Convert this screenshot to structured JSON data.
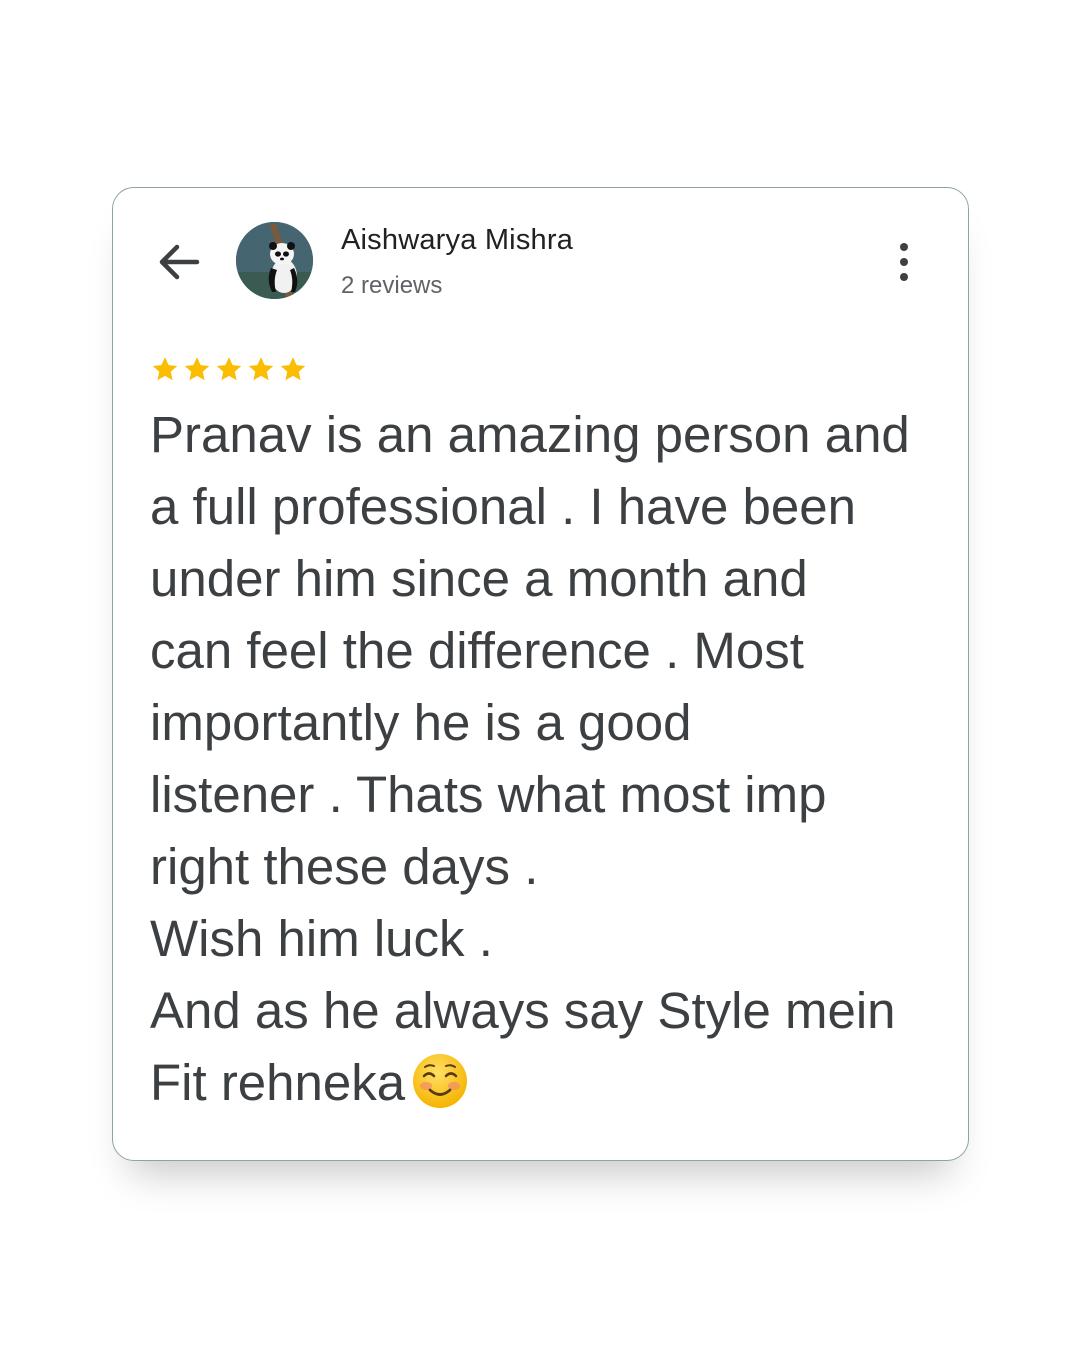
{
  "reviewer": {
    "name": "Aishwarya Mishra",
    "review_count": "2 reviews",
    "avatar_icon": "panda-avatar"
  },
  "icons": {
    "back": "arrow-left-icon",
    "more": "more-vertical-icon",
    "star": "star-icon",
    "emoji": "smiling-face-emoji"
  },
  "rating": {
    "stars": 5,
    "max": 5,
    "color": "#fbbc04"
  },
  "review": {
    "line1": "Pranav is an amazing person and",
    "line2": "a full professional . I have been",
    "line3": "under him since a month and",
    "line4": "can feel the difference . Most",
    "line5": "importantly he is a good",
    "line6": "listener . Thats what most imp",
    "line7": "right these days .",
    "line8": "Wish him luck .",
    "line9": "And as he always say Style mein",
    "line10": "Fit rehneka"
  },
  "colors": {
    "text": "#3c4043",
    "name": "#202124",
    "secondary": "#5f6368",
    "card_border": "#8fa3a3"
  }
}
